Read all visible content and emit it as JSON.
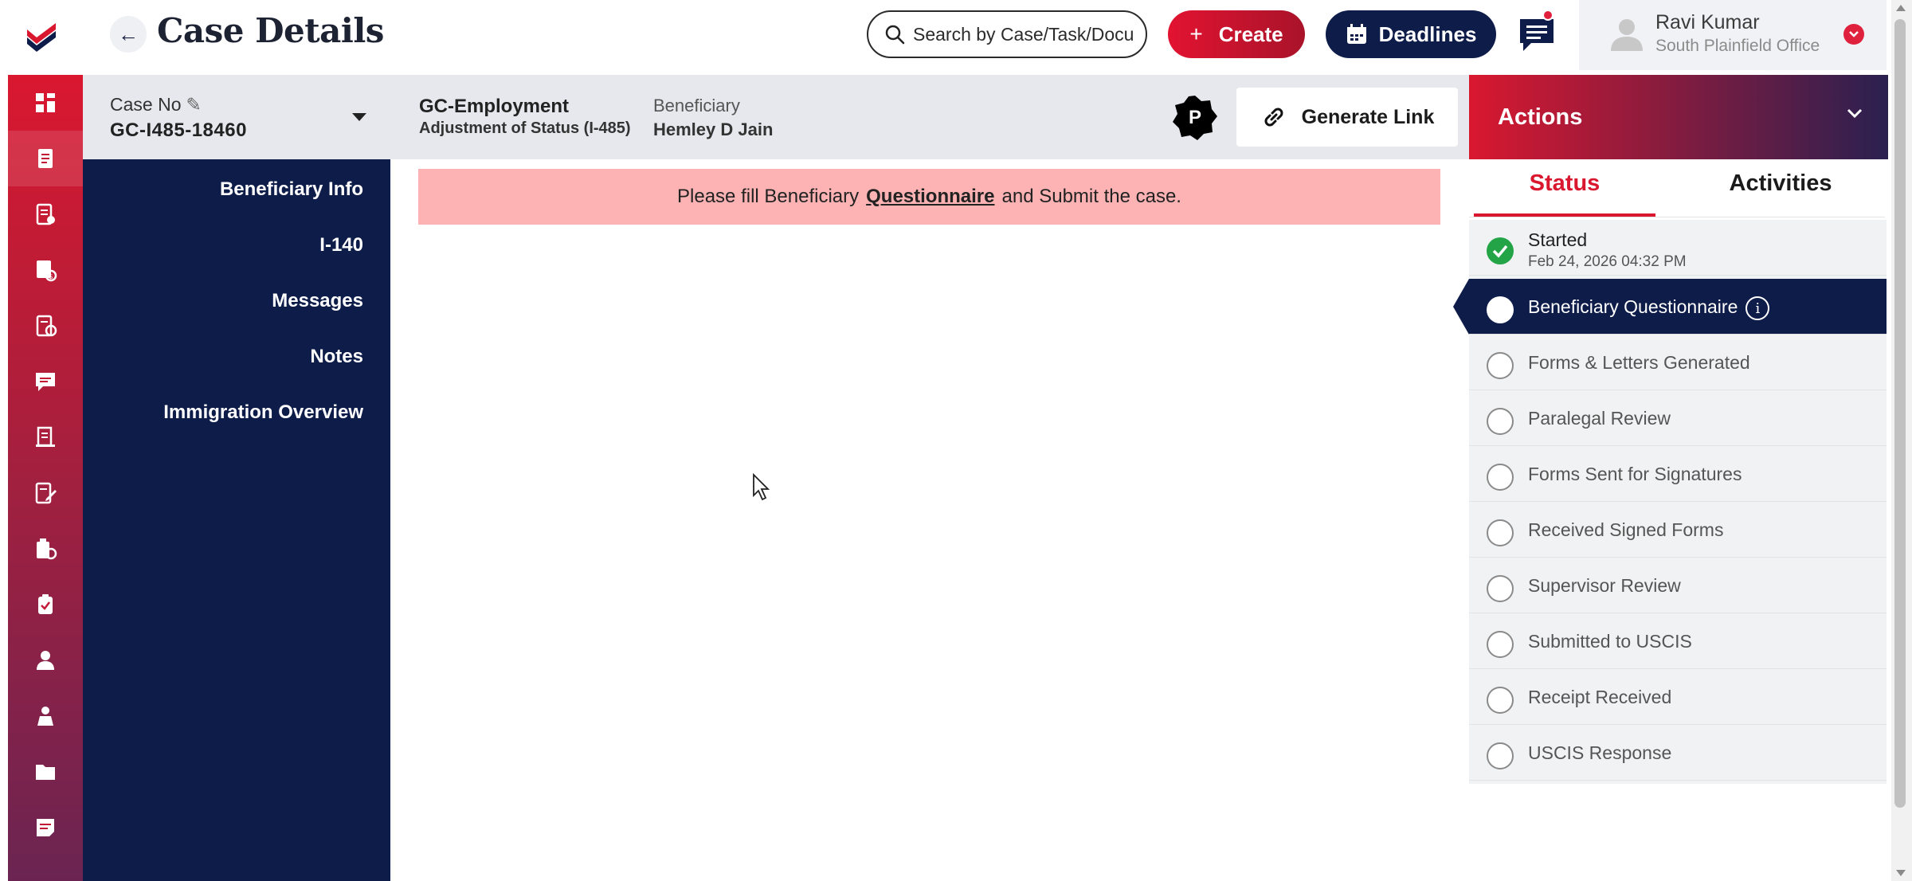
{
  "header": {
    "title": "Case Details",
    "search_placeholder": "Search by Case/Task/Docu",
    "create_label": "Create",
    "deadlines_label": "Deadlines",
    "user_name": "Ravi Kumar",
    "user_office": "South Plainfield Office"
  },
  "case": {
    "case_no_label": "Case No",
    "case_no": "GC-I485-18460",
    "case_type": "GC-Employment",
    "case_subtype": "Adjustment of Status (I-485)",
    "beneficiary_label": "Beneficiary",
    "beneficiary_name": "Hemley D Jain",
    "badge_letter": "P",
    "generate_link_label": "Generate Link"
  },
  "nav": {
    "items": [
      "Beneficiary Info",
      "I-140",
      "Messages",
      "Notes",
      "Immigration Overview"
    ]
  },
  "alert": {
    "prefix": "Please fill Beneficiary",
    "link": "Questionnaire",
    "suffix": "and Submit the case."
  },
  "actions": {
    "title": "Actions",
    "tabs": [
      "Status",
      "Activities"
    ],
    "steps": [
      {
        "label": "Started",
        "date": "Feb 24, 2026 04:32 PM",
        "state": "done"
      },
      {
        "label": "Beneficiary Questionnaire",
        "state": "current"
      },
      {
        "label": "Forms & Letters Generated",
        "state": "pending"
      },
      {
        "label": "Paralegal Review",
        "state": "pending"
      },
      {
        "label": "Forms Sent for Signatures",
        "state": "pending"
      },
      {
        "label": "Received Signed Forms",
        "state": "pending"
      },
      {
        "label": "Supervisor Review",
        "state": "pending"
      },
      {
        "label": "Submitted to USCIS",
        "state": "pending"
      },
      {
        "label": "Receipt Received",
        "state": "pending"
      },
      {
        "label": "USCIS Response",
        "state": "pending"
      }
    ]
  },
  "rail": {
    "icons": [
      "dashboard-icon",
      "cases-icon",
      "documents-icon",
      "billing-icon",
      "tasks-icon",
      "messages-icon",
      "forms-icon",
      "edit-forms-icon",
      "reports-icon",
      "checklist-icon",
      "client-icon",
      "contacts-icon",
      "folder-icon",
      "notes-icon"
    ]
  },
  "colors": {
    "brand_red": "#d9182f",
    "navy": "#0e1c4a",
    "alert_bg": "#fdb3b3",
    "success": "#22a447"
  }
}
